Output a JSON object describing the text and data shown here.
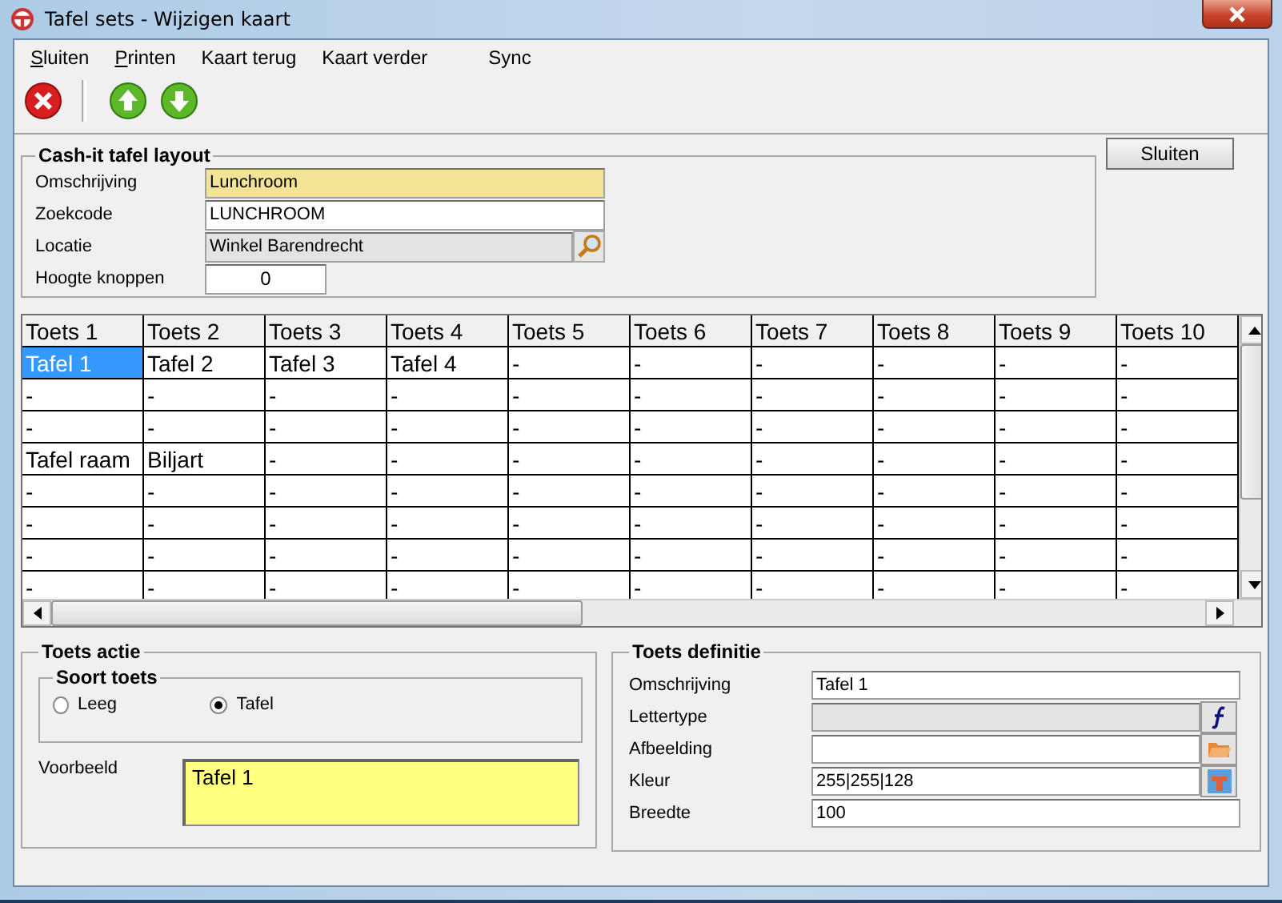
{
  "window": {
    "title": "Tafel sets - Wijzigen kaart"
  },
  "menu": [
    {
      "label": "Sluiten",
      "mnemonic": true
    },
    {
      "label": "Printen",
      "mnemonic": true
    },
    {
      "label": "Kaart terug",
      "mnemonic": false
    },
    {
      "label": "Kaart verder",
      "mnemonic": false
    },
    {
      "label": "Sync",
      "mnemonic": false
    }
  ],
  "toolbar": [
    {
      "kind": "close"
    },
    {
      "kind": "separator"
    },
    {
      "kind": "up"
    },
    {
      "kind": "down"
    }
  ],
  "layout_group": {
    "title": "Cash-it tafel layout",
    "fields": [
      {
        "label": "Omschrijving",
        "value": "Lunchroom",
        "kind": "highlighted"
      },
      {
        "label": "Zoekcode",
        "value": "LUNCHROOM",
        "kind": "text"
      },
      {
        "label": "Locatie",
        "value": "Winkel Barendrecht",
        "kind": "lookup"
      },
      {
        "label": "Hoogte knoppen",
        "value": "0",
        "kind": "number"
      }
    ]
  },
  "close_button": "Sluiten",
  "grid": {
    "columns": [
      "Toets 1",
      "Toets 2",
      "Toets 3",
      "Toets 4",
      "Toets 5",
      "Toets 6",
      "Toets 7",
      "Toets 8",
      "Toets 9",
      "Toets 10"
    ],
    "rows": [
      [
        {
          "text": "Tafel 1",
          "selected": true
        },
        {
          "text": "Tafel 2",
          "selected": false
        },
        {
          "text": "Tafel 3",
          "selected": false
        },
        {
          "text": "Tafel 4",
          "selected": false
        },
        {
          "text": "-",
          "selected": false
        },
        {
          "text": "-",
          "selected": false
        },
        {
          "text": "-",
          "selected": false
        },
        {
          "text": "-",
          "selected": false
        },
        {
          "text": "-",
          "selected": false
        },
        {
          "text": "-",
          "selected": false
        }
      ],
      [
        {
          "text": "-",
          "selected": false
        },
        {
          "text": "-",
          "selected": false
        },
        {
          "text": "-",
          "selected": false
        },
        {
          "text": "-",
          "selected": false
        },
        {
          "text": "-",
          "selected": false
        },
        {
          "text": "-",
          "selected": false
        },
        {
          "text": "-",
          "selected": false
        },
        {
          "text": "-",
          "selected": false
        },
        {
          "text": "-",
          "selected": false
        },
        {
          "text": "-",
          "selected": false
        }
      ],
      [
        {
          "text": "-",
          "selected": false
        },
        {
          "text": "-",
          "selected": false
        },
        {
          "text": "-",
          "selected": false
        },
        {
          "text": "-",
          "selected": false
        },
        {
          "text": "-",
          "selected": false
        },
        {
          "text": "-",
          "selected": false
        },
        {
          "text": "-",
          "selected": false
        },
        {
          "text": "-",
          "selected": false
        },
        {
          "text": "-",
          "selected": false
        },
        {
          "text": "-",
          "selected": false
        }
      ],
      [
        {
          "text": "Tafel raam",
          "selected": false
        },
        {
          "text": "Biljart",
          "selected": false
        },
        {
          "text": "-",
          "selected": false
        },
        {
          "text": "-",
          "selected": false
        },
        {
          "text": "-",
          "selected": false
        },
        {
          "text": "-",
          "selected": false
        },
        {
          "text": "-",
          "selected": false
        },
        {
          "text": "-",
          "selected": false
        },
        {
          "text": "-",
          "selected": false
        },
        {
          "text": "-",
          "selected": false
        }
      ],
      [
        {
          "text": "-",
          "selected": false
        },
        {
          "text": "-",
          "selected": false
        },
        {
          "text": "-",
          "selected": false
        },
        {
          "text": "-",
          "selected": false
        },
        {
          "text": "-",
          "selected": false
        },
        {
          "text": "-",
          "selected": false
        },
        {
          "text": "-",
          "selected": false
        },
        {
          "text": "-",
          "selected": false
        },
        {
          "text": "-",
          "selected": false
        },
        {
          "text": "-",
          "selected": false
        }
      ],
      [
        {
          "text": "-",
          "selected": false
        },
        {
          "text": "-",
          "selected": false
        },
        {
          "text": "-",
          "selected": false
        },
        {
          "text": "-",
          "selected": false
        },
        {
          "text": "-",
          "selected": false
        },
        {
          "text": "-",
          "selected": false
        },
        {
          "text": "-",
          "selected": false
        },
        {
          "text": "-",
          "selected": false
        },
        {
          "text": "-",
          "selected": false
        },
        {
          "text": "-",
          "selected": false
        }
      ],
      [
        {
          "text": "-",
          "selected": false
        },
        {
          "text": "-",
          "selected": false
        },
        {
          "text": "-",
          "selected": false
        },
        {
          "text": "-",
          "selected": false
        },
        {
          "text": "-",
          "selected": false
        },
        {
          "text": "-",
          "selected": false
        },
        {
          "text": "-",
          "selected": false
        },
        {
          "text": "-",
          "selected": false
        },
        {
          "text": "-",
          "selected": false
        },
        {
          "text": "-",
          "selected": false
        }
      ],
      [
        {
          "text": "-",
          "selected": false
        },
        {
          "text": "-",
          "selected": false
        },
        {
          "text": "-",
          "selected": false
        },
        {
          "text": "-",
          "selected": false
        },
        {
          "text": "-",
          "selected": false
        },
        {
          "text": "-",
          "selected": false
        },
        {
          "text": "-",
          "selected": false
        },
        {
          "text": "-",
          "selected": false
        },
        {
          "text": "-",
          "selected": false
        },
        {
          "text": "-",
          "selected": false
        }
      ]
    ]
  },
  "action_group": {
    "title": "Toets actie",
    "type_group": {
      "title": "Soort toets",
      "options": [
        {
          "label": "Leeg",
          "selected": false
        },
        {
          "label": "Tafel",
          "selected": true
        }
      ]
    },
    "preview_label": "Voorbeeld",
    "preview_text": "Tafel 1"
  },
  "definition_group": {
    "title": "Toets definitie",
    "fields": [
      {
        "label": "Omschrijving",
        "value": "Tafel 1",
        "kind": "text"
      },
      {
        "label": "Lettertype",
        "kind": "font"
      },
      {
        "label": "Afbeelding",
        "kind": "image"
      },
      {
        "label": "Kleur",
        "value": "255|255|128",
        "kind": "color"
      },
      {
        "label": "Breedte",
        "value": "100",
        "kind": "text"
      }
    ]
  }
}
